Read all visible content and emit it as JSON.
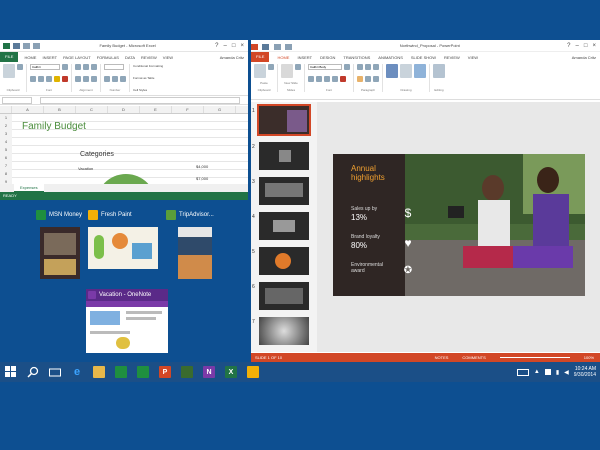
{
  "excel": {
    "title": "Family Budget - Microsoft Excel",
    "file_tab": "FILE",
    "tabs": [
      "HOME",
      "INSERT",
      "PAGE LAYOUT",
      "FORMULAS",
      "DATA",
      "REVIEW",
      "VIEW"
    ],
    "signin": "Amanda Critz",
    "font_name": "Calibri",
    "ribbon_labels": [
      "Clipboard",
      "Font",
      "Alignment",
      "Number",
      "Styles"
    ],
    "style_items": [
      "Conditional Formatting",
      "Format as Table",
      "Cell Styles"
    ],
    "columns": [
      "A",
      "B",
      "C",
      "D",
      "E",
      "F",
      "G"
    ],
    "rows": [
      "1",
      "2",
      "3",
      "4",
      "5",
      "6",
      "7",
      "8",
      "9"
    ],
    "budget_title": "Family Budget",
    "categories_title": "Categories",
    "vacation_label": "Vacation",
    "amount_1": "$4,000",
    "amount_2": "$7,000",
    "sheet_tab": "Expenses",
    "status": "READY"
  },
  "snap": {
    "apps": [
      {
        "name": "MSN Money",
        "color": "#1f8f3f"
      },
      {
        "name": "Fresh Paint",
        "color": "#f2b007"
      },
      {
        "name": "TripAdvisor...",
        "color": "#5a9e3a"
      },
      {
        "name": "Vacation - OneNote",
        "color": "#7a3aa8"
      }
    ]
  },
  "ppt": {
    "title": "Northwind_Proposal - PowerPoint",
    "file_tab": "FILE",
    "tabs": [
      "HOME",
      "INSERT",
      "DESIGN",
      "TRANSITIONS",
      "ANIMATIONS",
      "SLIDE SHOW",
      "REVIEW",
      "VIEW"
    ],
    "signin": "Amanda Critz",
    "font_name": "Calibri Body",
    "ribbon_labels": [
      "Clipboard",
      "Slides",
      "Font",
      "Paragraph",
      "Drawing",
      "Editing"
    ],
    "ribbon_buttons": [
      "Paste",
      "New Slide",
      "Shapes",
      "Arrange",
      "Quick Styles",
      "Editing"
    ],
    "slide_numbers": [
      "1",
      "2",
      "3",
      "4",
      "5",
      "6",
      "7"
    ],
    "slide": {
      "title": "Annual highlights",
      "stats": [
        {
          "label": "Sales up by",
          "value": "13%"
        },
        {
          "label": "Brand loyalty",
          "value": "80%"
        },
        {
          "label": "Environmental award",
          "value": ""
        }
      ]
    },
    "status_slide": "SLIDE 1 OF 10",
    "status_notes": "NOTES",
    "status_comments": "COMMENTS",
    "zoom": "100%"
  },
  "taskbar": {
    "apps": [
      {
        "name": "start",
        "color": "#1b4f87",
        "glyph": ""
      },
      {
        "name": "search",
        "color": "#1b4f87",
        "glyph": ""
      },
      {
        "name": "task-view",
        "color": "#1b4f87",
        "glyph": ""
      },
      {
        "name": "internet-explorer",
        "color": "#1b4f87",
        "glyph": "e"
      },
      {
        "name": "file-explorer",
        "color": "#e8b84a",
        "glyph": ""
      },
      {
        "name": "store",
        "color": "#1f8f3f",
        "glyph": ""
      },
      {
        "name": "finance",
        "color": "#1f8f3f",
        "glyph": ""
      },
      {
        "name": "powerpoint",
        "color": "#d24726",
        "glyph": "P"
      },
      {
        "name": "tripadvisor",
        "color": "#3a6b2e",
        "glyph": ""
      },
      {
        "name": "onenote",
        "color": "#7a3aa8",
        "glyph": "N"
      },
      {
        "name": "excel",
        "color": "#217346",
        "glyph": "X"
      },
      {
        "name": "fresh-paint",
        "color": "#f2b007",
        "glyph": ""
      }
    ],
    "time": "10:24 AM",
    "date": "9/30/2014"
  }
}
